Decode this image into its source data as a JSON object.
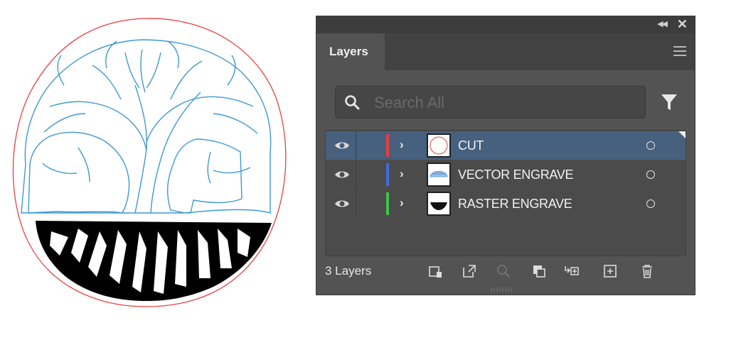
{
  "canvas": {
    "artwork": "tree-of-life-icon",
    "cut_color": "#e8413f",
    "vector_color": "#3f98d3",
    "raster_color": "#000000"
  },
  "panel": {
    "tab_label": "Layers",
    "search_placeholder": "Search All",
    "layers": [
      {
        "name": "CUT",
        "color": "#e63e3e",
        "selected": true
      },
      {
        "name": "VECTOR ENGRAVE",
        "color": "#3d6de0",
        "selected": false
      },
      {
        "name": "RASTER ENGRAVE",
        "color": "#3ec449",
        "selected": false
      }
    ],
    "layer_count": "3 Layers",
    "icons": {
      "collapse": "collapse-icon",
      "close": "close-icon",
      "menu": "menu-icon",
      "search": "search-icon",
      "filter": "filter-icon",
      "eye": "eye-icon",
      "expand": "chevron-right-icon",
      "target": "target-circle-icon",
      "footer": [
        "artboard-clip-icon",
        "export-icon",
        "locate-object-icon",
        "clipping-mask-icon",
        "sublayer-icon",
        "new-layer-icon",
        "delete-icon"
      ]
    }
  }
}
